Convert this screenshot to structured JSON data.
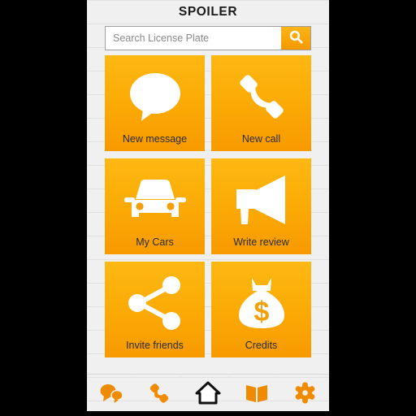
{
  "app": {
    "title": "SPOILER",
    "accent_color": "#F79A00",
    "accent_color_light": "#FDB813",
    "background_color": "#F0F0F0",
    "text_color": "#2B2B2B"
  },
  "search": {
    "placeholder": "Search License Plate",
    "value": "",
    "button_icon": "search-icon"
  },
  "grid": {
    "tiles": [
      {
        "label": "New message",
        "icon": "speech-bubble-icon",
        "name": "tile-new-message"
      },
      {
        "label": "New call",
        "icon": "phone-handset-icon",
        "name": "tile-new-call"
      },
      {
        "label": "My Cars",
        "icon": "car-icon",
        "name": "tile-my-cars"
      },
      {
        "label": "Write review",
        "icon": "megaphone-icon",
        "name": "tile-write-review"
      },
      {
        "label": "Invite friends",
        "icon": "share-icon",
        "name": "tile-invite-friends"
      },
      {
        "label": "Credits",
        "icon": "money-bag-icon",
        "name": "tile-credits"
      }
    ]
  },
  "navbar": {
    "items": [
      {
        "icon": "chat-bubbles-icon",
        "name": "nav-messages",
        "active": false,
        "color": "#F08A00"
      },
      {
        "icon": "phone-icon",
        "name": "nav-calls",
        "active": false,
        "color": "#F08A00"
      },
      {
        "icon": "home-icon",
        "name": "nav-home",
        "active": true,
        "color": "#1A1A1A"
      },
      {
        "icon": "book-icon",
        "name": "nav-guide",
        "active": false,
        "color": "#F08A00"
      },
      {
        "icon": "gear-icon",
        "name": "nav-settings",
        "active": false,
        "color": "#F08A00"
      }
    ]
  }
}
